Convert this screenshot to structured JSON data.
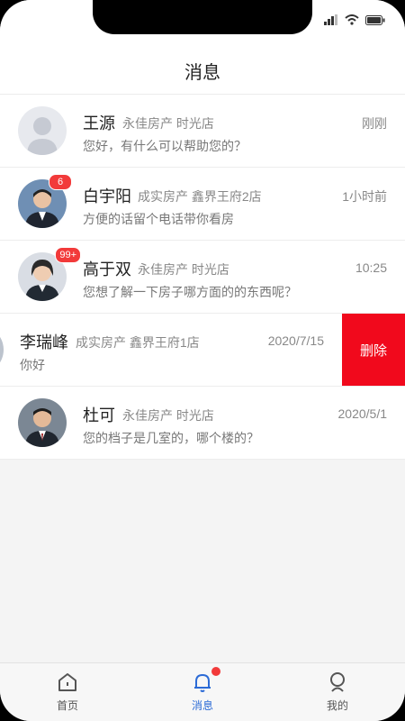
{
  "header": {
    "title": "消息"
  },
  "messages": [
    {
      "name": "王源",
      "agency": "永佳房产 时光店",
      "time": "刚刚",
      "text": "您好，有什么可以帮助您的？",
      "badge": ""
    },
    {
      "name": "白宇阳",
      "agency": "成实房产 鑫界王府2店",
      "time": "1小时前",
      "text": "方便的话留个电话带你看房",
      "badge": "6"
    },
    {
      "name": "高于双",
      "agency": "永佳房产 时光店",
      "time": "10:25",
      "text": "您想了解一下房子哪方面的的东西呢？",
      "badge": "99+"
    },
    {
      "name": "李瑞峰",
      "agency": "成实房产 鑫界王府1店",
      "time": "2020/7/15",
      "text": "你好",
      "badge": "",
      "action": "删除"
    },
    {
      "name": "杜可",
      "agency": "永佳房产 时光店",
      "time": "2020/5/1",
      "text": "您的档子是几室的，哪个楼的？",
      "badge": ""
    }
  ],
  "tabs": [
    {
      "label": "首页",
      "icon": "home-icon"
    },
    {
      "label": "消息",
      "icon": "bell-icon",
      "active": true
    },
    {
      "label": "我的",
      "icon": "profile-icon"
    }
  ],
  "colors": {
    "accent": "#2c6bd6",
    "delete": "#f1091c",
    "badge": "#f23a3a"
  }
}
